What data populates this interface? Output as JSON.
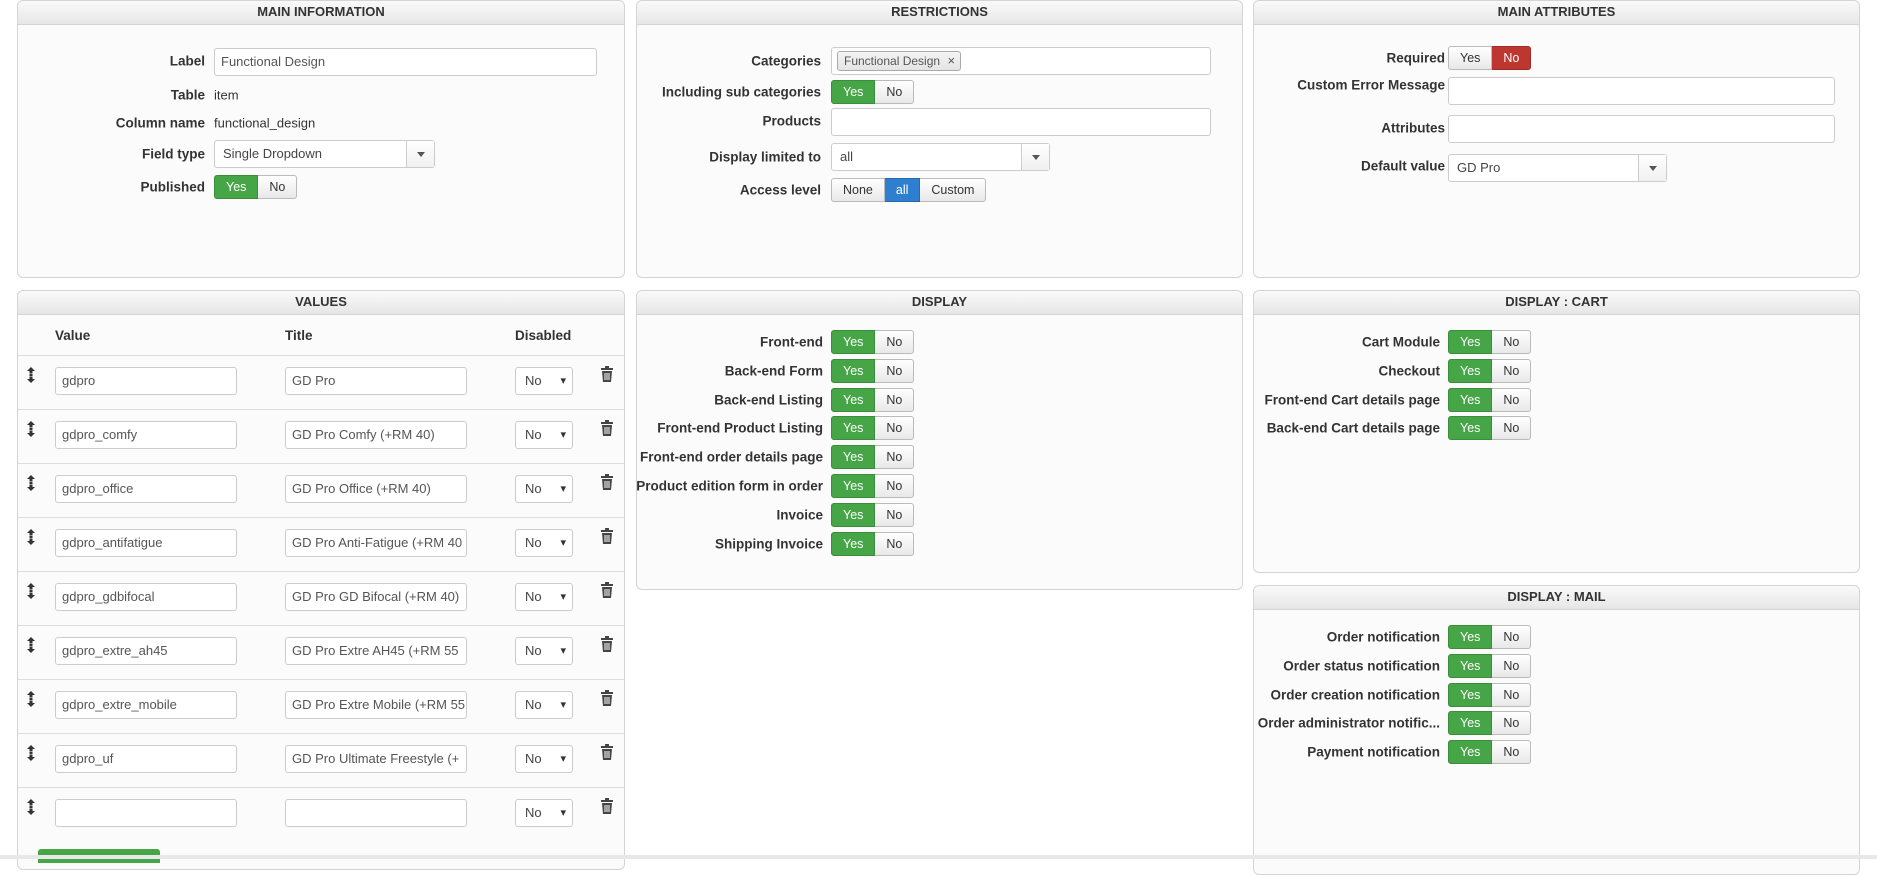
{
  "main_info": {
    "title": "MAIN INFORMATION",
    "label_label": "Label",
    "label_value": "Functional Design",
    "table_label": "Table",
    "table_value": "item",
    "column_label": "Column name",
    "column_value": "functional_design",
    "fieldtype_label": "Field type",
    "fieldtype_value": "Single Dropdown",
    "published_label": "Published",
    "yes": "Yes",
    "no": "No"
  },
  "restrictions": {
    "title": "RESTRICTIONS",
    "categories_label": "Categories",
    "category_tag": "Functional Design",
    "tag_remove": "×",
    "subcat_label": "Including sub categories",
    "products_label": "Products",
    "display_limited_label": "Display limited to",
    "display_limited_value": "all",
    "access_label": "Access level",
    "access_options": [
      "None",
      "all",
      "Custom"
    ],
    "yes": "Yes",
    "no": "No"
  },
  "main_attributes": {
    "title": "MAIN ATTRIBUTES",
    "required_label": "Required",
    "custom_error_label": "Custom Error Message",
    "attributes_label": "Attributes",
    "default_label": "Default value",
    "default_value": "GD Pro",
    "yes": "Yes",
    "no": "No"
  },
  "values": {
    "title": "VALUES",
    "col_value": "Value",
    "col_title": "Title",
    "col_disabled": "Disabled",
    "rows": [
      {
        "value": "gdpro",
        "title": "GD Pro",
        "disabled": "No"
      },
      {
        "value": "gdpro_comfy",
        "title": "GD Pro Comfy (+RM 40)",
        "disabled": "No"
      },
      {
        "value": "gdpro_office",
        "title": "GD Pro Office (+RM 40)",
        "disabled": "No"
      },
      {
        "value": "gdpro_antifatigue",
        "title": "GD Pro Anti-Fatigue (+RM 40",
        "disabled": "No"
      },
      {
        "value": "gdpro_gdbifocal",
        "title": "GD Pro GD Bifocal (+RM 40)",
        "disabled": "No"
      },
      {
        "value": "gdpro_extre_ah45",
        "title": "GD Pro Extre AH45 (+RM 55",
        "disabled": "No"
      },
      {
        "value": "gdpro_extre_mobile",
        "title": "GD Pro Extre Mobile (+RM 55",
        "disabled": "No"
      },
      {
        "value": "gdpro_uf",
        "title": "GD Pro Ultimate Freestyle (+",
        "disabled": "No"
      },
      {
        "value": "",
        "title": "",
        "disabled": "No"
      }
    ]
  },
  "display": {
    "title": "DISPLAY",
    "yes": "Yes",
    "no": "No",
    "items": [
      "Front-end",
      "Back-end Form",
      "Back-end Listing",
      "Front-end Product Listing",
      "Front-end order details page",
      "Product edition form in order",
      "Invoice",
      "Shipping Invoice"
    ]
  },
  "display_cart": {
    "title": "DISPLAY : CART",
    "yes": "Yes",
    "no": "No",
    "items": [
      "Cart Module",
      "Checkout",
      "Front-end Cart details page",
      "Back-end Cart details page"
    ]
  },
  "display_mail": {
    "title": "DISPLAY : MAIL",
    "yes": "Yes",
    "no": "No",
    "items": [
      "Order notification",
      "Order status notification",
      "Order creation notification",
      "Order administrator notific...",
      "Payment notification"
    ]
  },
  "colors": {
    "green": "#46a546",
    "red": "#bd362f",
    "blue": "#2f7fd1"
  }
}
